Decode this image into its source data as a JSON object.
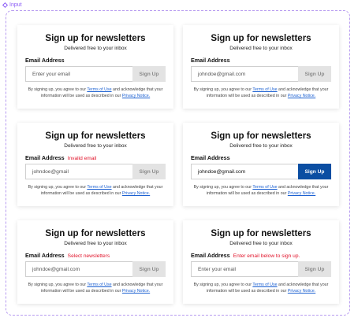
{
  "frame": {
    "tag": "Input"
  },
  "cards": [
    {
      "title": "Sign up for newsletters",
      "subtitle": "Delivered free to your inbox",
      "label": "Email Address",
      "error": "",
      "input": "Enter your email",
      "button": "Sign Up",
      "legal_pre": "By signing up, you agree to our",
      "terms": "Terms of Use",
      "legal_mid": "and acknowledge that your information will be used as described in our",
      "privacy": "Privacy Notice."
    },
    {
      "title": "Sign up for newsletters",
      "subtitle": "Delivered free to your inbox",
      "label": "Email Address",
      "error": "",
      "input": "johndoe@gmail.com",
      "button": "Sign Up",
      "legal_pre": "By signing up, you agree to our",
      "terms": "Terms of Use",
      "legal_mid": "and acknowledge that your information will be used as described in our",
      "privacy": "Privacy Notice."
    },
    {
      "title": "Sign up for newsletters",
      "subtitle": "Delivered free to your inbox",
      "label": "Email Address",
      "error": "Invalid email",
      "input": "johndoe@gmail",
      "button": "Sign Up",
      "legal_pre": "By signing up, you agree to our",
      "terms": "Terms of Use",
      "legal_mid": "and acknowledge that your information will be used as described in our",
      "privacy": "Privacy Notice."
    },
    {
      "title": "Sign up for newsletters",
      "subtitle": "Delivered free to your inbox",
      "label": "Email Address",
      "error": "",
      "input": "johndoe@gmail.com",
      "button": "Sign Up",
      "legal_pre": "By signing up, you agree to our",
      "terms": "Terms of Use",
      "legal_mid": "and acknowledge that your information will be used as described in our",
      "privacy": "Privacy Notice."
    },
    {
      "title": "Sign up for newsletters",
      "subtitle": "Delivered free to your inbox",
      "label": "Email Address",
      "error": "Select newsletters",
      "input": "johndoe@gmail.com",
      "button": "Sign Up",
      "legal_pre": "By signing up, you agree to our",
      "terms": "Terms of Use",
      "legal_mid": "and acknowledge that your information will be used as described in our",
      "privacy": "Privacy Notice."
    },
    {
      "title": "Sign up for newsletters",
      "subtitle": "Delivered free to your inbox",
      "label": "Email Address",
      "error": "Enter email below to sign up.",
      "input": "Enter your email",
      "button": "Sign Up",
      "legal_pre": "By signing up, you agree to our",
      "terms": "Terms of Use",
      "legal_mid": "and acknowledge that your information will be used as described in our",
      "privacy": "Privacy Notice."
    }
  ],
  "colors": {
    "frame_border": "#b79bf0",
    "error": "#e1132a",
    "button_active": "#0b4ea2",
    "link": "#1a5fd1"
  }
}
